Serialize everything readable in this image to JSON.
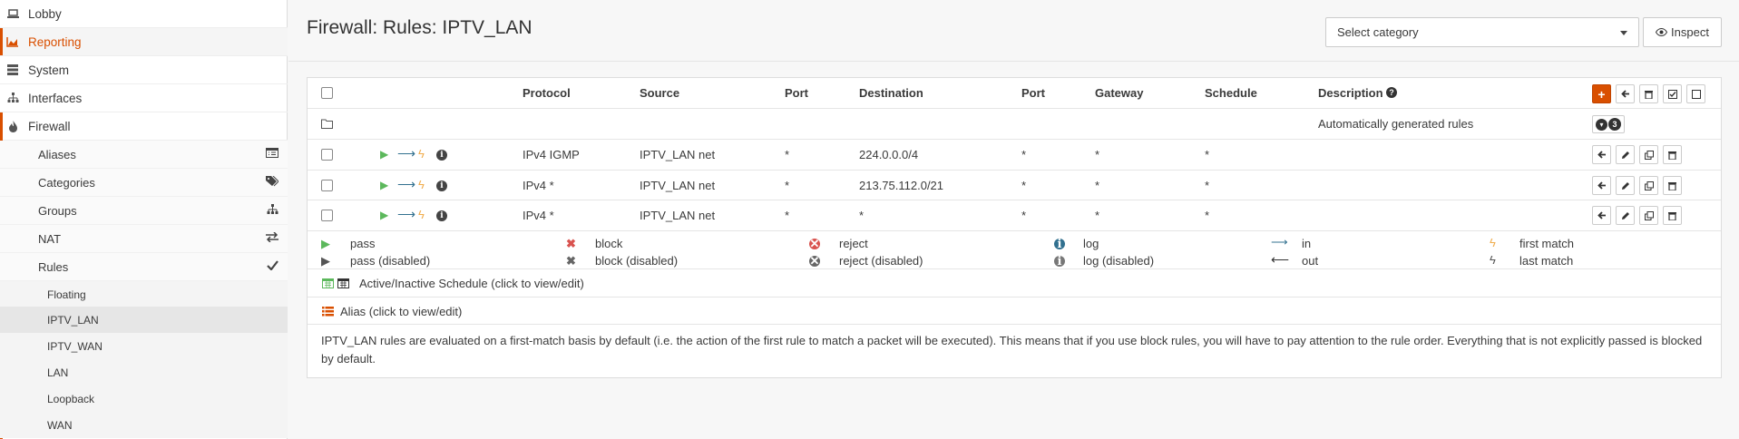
{
  "sidebar": {
    "items": [
      {
        "label": "Lobby",
        "icon": "laptop-icon"
      },
      {
        "label": "Reporting",
        "icon": "area-chart-icon"
      },
      {
        "label": "System",
        "icon": "server-icon"
      },
      {
        "label": "Interfaces",
        "icon": "sitemap-icon"
      },
      {
        "label": "Firewall",
        "icon": "fire-icon"
      }
    ],
    "firewall_sub": [
      {
        "label": "Aliases",
        "icon": "list-alt-icon"
      },
      {
        "label": "Categories",
        "icon": "tags-icon"
      },
      {
        "label": "Groups",
        "icon": "sitemap-icon"
      },
      {
        "label": "NAT",
        "icon": "exchange-icon"
      },
      {
        "label": "Rules",
        "icon": "check-icon"
      }
    ],
    "rules_sub": [
      {
        "label": "Floating"
      },
      {
        "label": "IPTV_LAN"
      },
      {
        "label": "IPTV_WAN"
      },
      {
        "label": "LAN"
      },
      {
        "label": "Loopback"
      },
      {
        "label": "WAN"
      }
    ]
  },
  "header": {
    "title": "Firewall: Rules: IPTV_LAN",
    "category_placeholder": "Select category",
    "inspect_label": "Inspect"
  },
  "table": {
    "columns": {
      "protocol": "Protocol",
      "source": "Source",
      "port": "Port",
      "destination": "Destination",
      "port2": "Port",
      "gateway": "Gateway",
      "schedule": "Schedule",
      "description": "Description"
    },
    "auto_row": {
      "description": "Automatically generated rules",
      "count": "3"
    },
    "rules": [
      {
        "protocol": "IPv4 IGMP",
        "source": "IPTV_LAN net",
        "port": "*",
        "destination": "224.0.0.0/4",
        "port2": "*",
        "gateway": "*",
        "schedule": "*"
      },
      {
        "protocol": "IPv4 *",
        "source": "IPTV_LAN net",
        "port": "*",
        "destination": "213.75.112.0/21",
        "port2": "*",
        "gateway": "*",
        "schedule": "*"
      },
      {
        "protocol": "IPv4 *",
        "source": "IPTV_LAN net",
        "port": "*",
        "destination": "*",
        "port2": "*",
        "gateway": "*",
        "schedule": "*"
      }
    ]
  },
  "legend": {
    "pass": "pass",
    "pass_disabled": "pass (disabled)",
    "block": "block",
    "block_disabled": "block (disabled)",
    "reject": "reject",
    "reject_disabled": "reject (disabled)",
    "log": "log",
    "log_disabled": "log (disabled)",
    "in": "in",
    "out": "out",
    "first_match": "first match",
    "last_match": "last match",
    "schedule_note": "Active/Inactive Schedule (click to view/edit)",
    "alias_note": "Alias (click to view/edit)"
  },
  "footer_note": "IPTV_LAN rules are evaluated on a first-match basis by default (i.e. the action of the first rule to match a packet will be executed). This means that if you use block rules, you will have to pay attention to the rule order. Everything that is not explicitly passed is blocked by default.",
  "colors": {
    "accent": "#d94f00",
    "pass": "#5cb85c",
    "block": "#d9534f",
    "direction": "#31708f",
    "match": "#f0ad4e"
  }
}
